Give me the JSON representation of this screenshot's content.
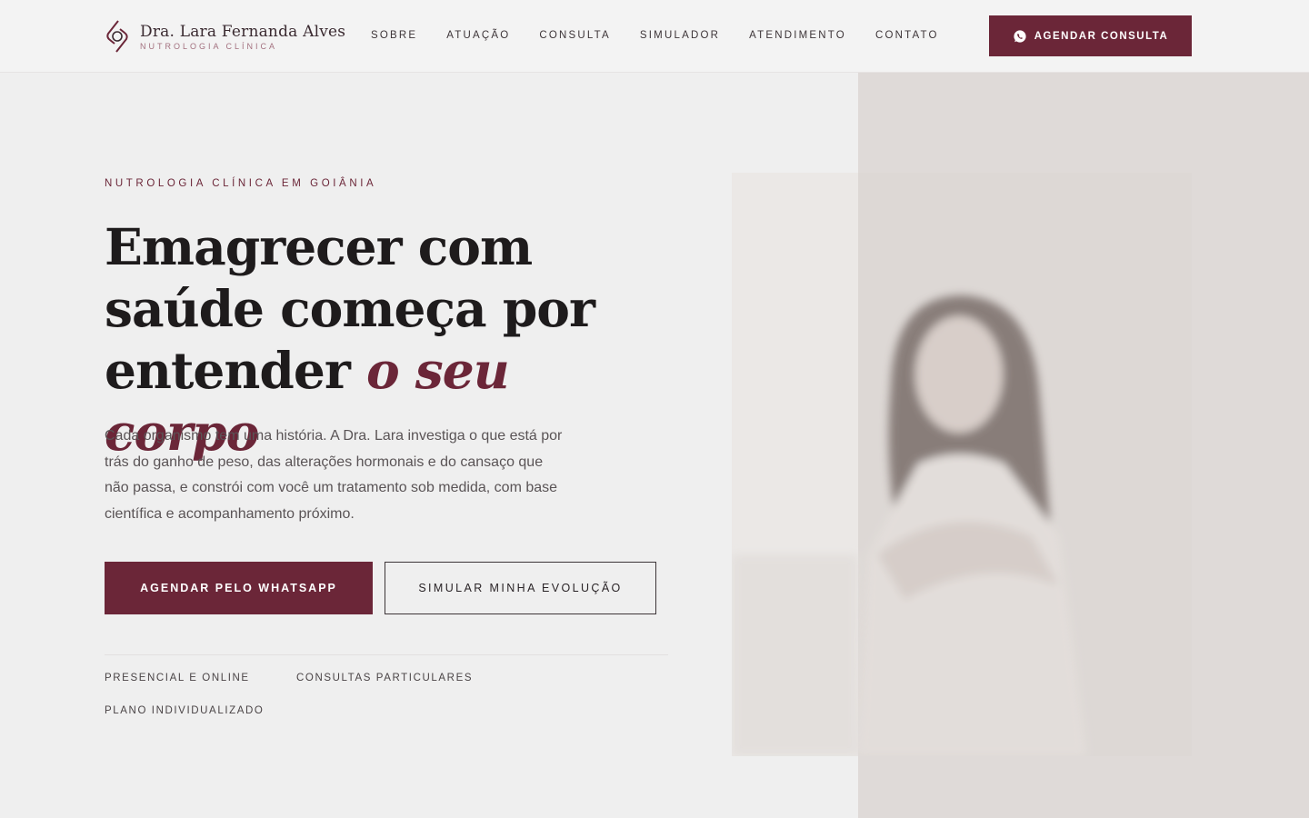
{
  "header": {
    "logo": {
      "name": "Dra. Lara Fernanda Alves",
      "subtitle": "NUTROLOGIA CLÍNICA"
    },
    "nav": [
      "SOBRE",
      "ATUAÇÃO",
      "CONSULTA",
      "SIMULADOR",
      "ATENDIMENTO",
      "CONTATO"
    ],
    "cta": {
      "label": "AGENDAR CONSULTA",
      "icon": "whatsapp-icon"
    }
  },
  "hero": {
    "eyebrow": "NUTROLOGIA CLÍNICA EM GOIÂNIA",
    "headline_line1": "Emagrecer com",
    "headline_line2": "saúde começa por",
    "headline_line3_plain": "entender ",
    "headline_line3_accent": "o seu corpo",
    "lead": "Cada organismo tem uma história. A Dra. Lara investiga o que está por trás do ganho de peso, das alterações hormonais e do cansaço que não passa, e constrói com você um tratamento sob medida, com base científica e acompanhamento próximo.",
    "primary_button": "AGENDAR PELO WHATSAPP",
    "secondary_button": "SIMULAR MINHA EVOLUÇÃO",
    "tags": [
      "PRESENCIAL E ONLINE",
      "CONSULTAS PARTICULARES",
      "PLANO INDIVIDUALIZADO"
    ]
  },
  "colors": {
    "brand": "#6b2638",
    "background": "#efefef",
    "photo_panel": "#dfdad8"
  }
}
